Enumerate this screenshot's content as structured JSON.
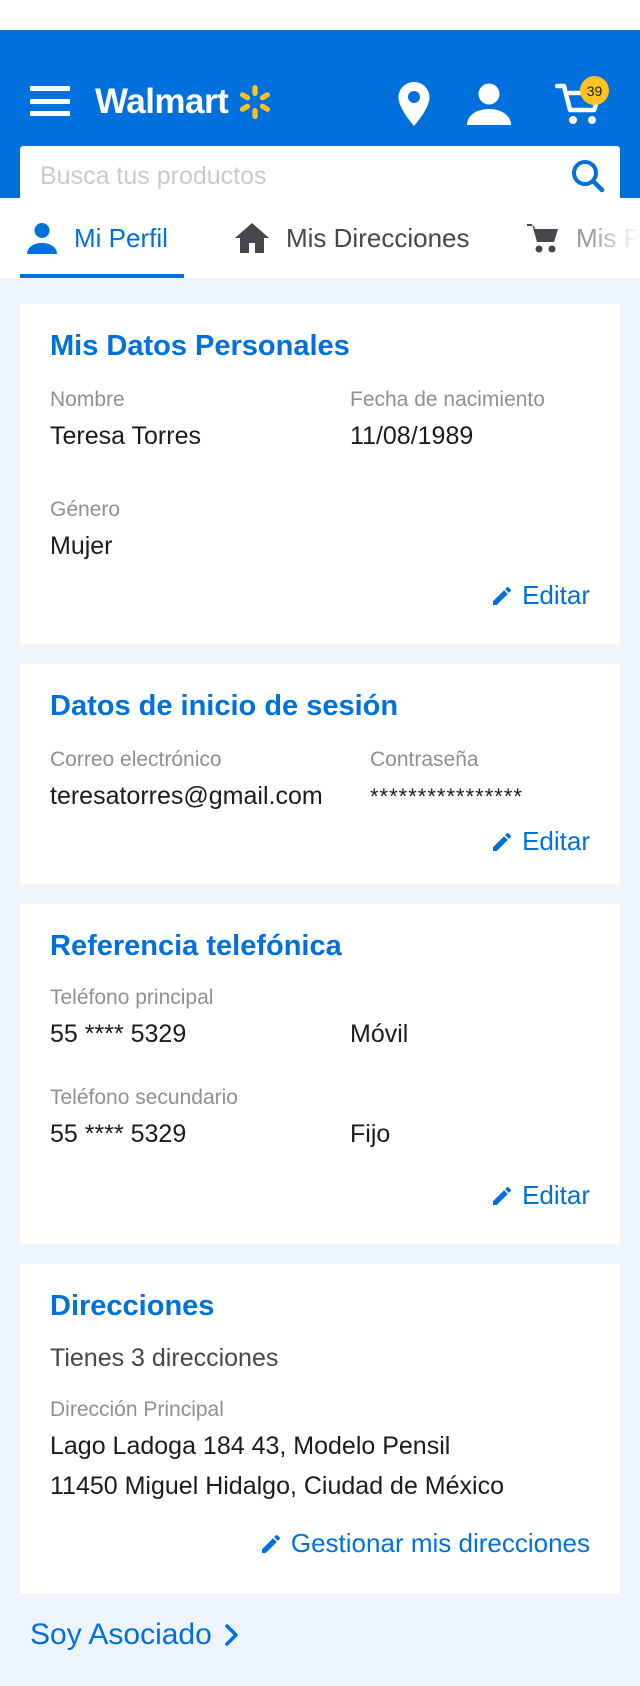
{
  "header": {
    "brand": "Walmart",
    "cart_count": "39",
    "search_placeholder": "Busca tus productos",
    "colors": {
      "brand_blue": "#0071dc",
      "spark_yellow": "#ffc220"
    }
  },
  "tabs": [
    {
      "label": "Mi Perfil",
      "icon": "person-icon",
      "active": true
    },
    {
      "label": "Mis Direcciones",
      "icon": "home-icon",
      "active": false
    },
    {
      "label": "Mis Pedidos",
      "icon": "cart-icon",
      "active": false
    }
  ],
  "personal": {
    "title": "Mis Datos Personales",
    "name_label": "Nombre",
    "name": "Teresa Torres",
    "birth_label": "Fecha de nacimiento",
    "birth": "11/08/1989",
    "gender_label": "Género",
    "gender": "Mujer",
    "edit": "Editar"
  },
  "login": {
    "title": "Datos de inicio de sesión",
    "email_label": "Correo electrónico",
    "email": "teresatorres@gmail.com",
    "password_label": "Contraseña",
    "password": "****************",
    "edit": "Editar"
  },
  "phone": {
    "title": "Referencia telefónica",
    "primary_label": "Teléfono principal",
    "primary": "55 **** 5329",
    "primary_type": "Móvil",
    "secondary_label": "Teléfono secundario",
    "secondary": "55 **** 5329",
    "secondary_type": "Fijo",
    "edit": "Editar"
  },
  "addresses": {
    "title": "Direcciones",
    "count_text": "Tienes 3 direcciones",
    "main_label": "Dirección Principal",
    "line1": "Lago Ladoga 184 43, Modelo Pensil",
    "line2": "11450 Miguel Hidalgo, Ciudad de México",
    "manage": "Gestionar mis direcciones"
  },
  "associate_link": "Soy Asociado"
}
